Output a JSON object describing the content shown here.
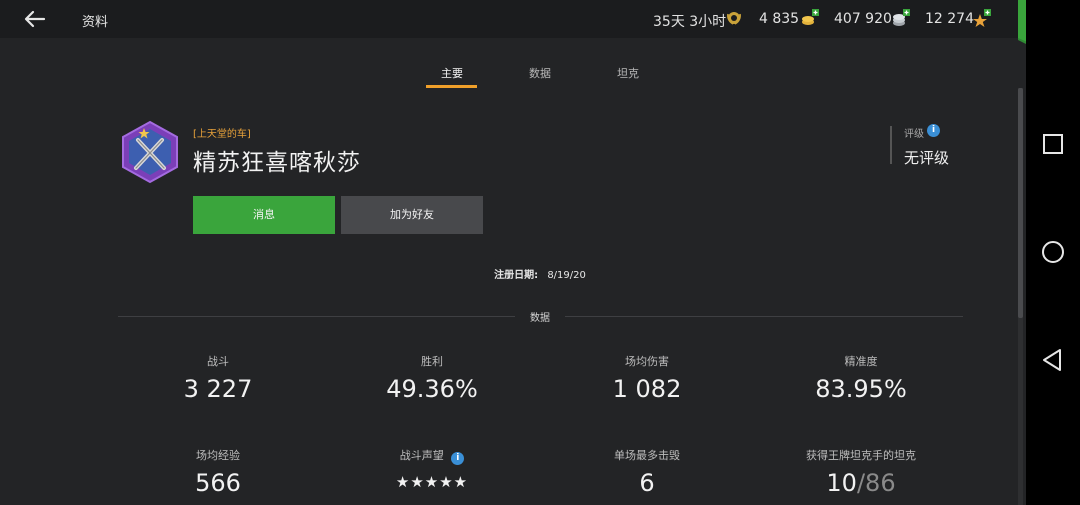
{
  "header": {
    "title": "资料",
    "timer": "35天 3小时",
    "gold": "4 835",
    "silver": "407 920",
    "free_xp": "12 274"
  },
  "tabs": [
    {
      "label": "主要"
    },
    {
      "label": "数据"
    },
    {
      "label": "坦克"
    }
  ],
  "profile": {
    "clan_tag": "[上天堂的车]",
    "name": "精苏狂喜喀秋莎",
    "rating_label": "评级",
    "rating_value": "无评级",
    "message_button": "消息",
    "add_friend_button": "加为好友",
    "registered_label": "注册日期:",
    "registered_value": "8/19/20"
  },
  "stats_section": {
    "title": "数据",
    "row1": [
      {
        "label": "战斗",
        "value": "3 227"
      },
      {
        "label": "胜利",
        "value": "49.36%"
      },
      {
        "label": "场均伤害",
        "value": "1 082"
      },
      {
        "label": "精准度",
        "value": "83.95%"
      }
    ],
    "row2": [
      {
        "label": "场均经验",
        "value": "566"
      },
      {
        "label": "战斗声望",
        "value": "★★★★★"
      },
      {
        "label": "单场最多击毁",
        "value": "6"
      },
      {
        "label": "获得王牌坦克手的坦克",
        "value": "10",
        "total": "86",
        "separator": "/"
      }
    ]
  },
  "colors": {
    "accent": "#f0a02a",
    "message_button": "#3aa53c",
    "shop": "#2f8a34",
    "info": "#3a8fd6"
  }
}
